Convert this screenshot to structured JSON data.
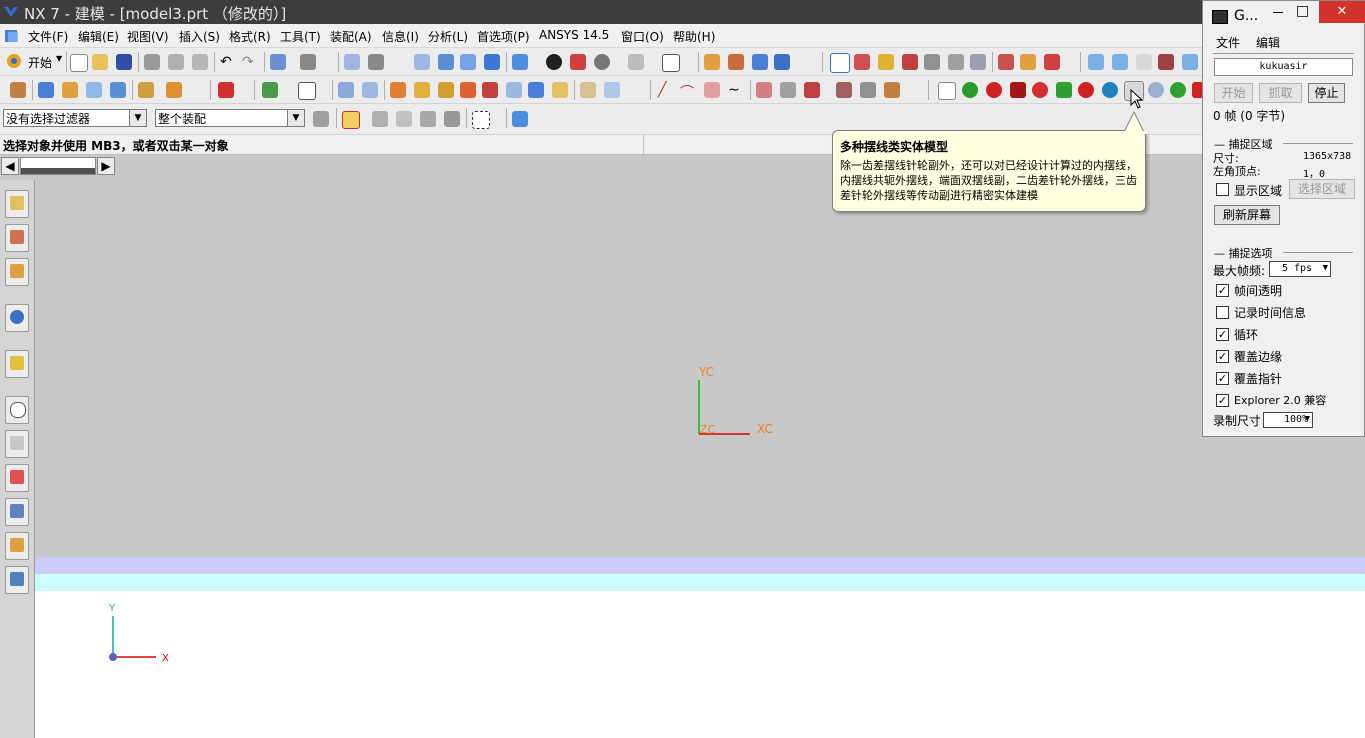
{
  "window": {
    "title": "NX 7 - 建模 - [model3.prt （修改的）]"
  },
  "menu": [
    {
      "label": "文件(F)"
    },
    {
      "label": "编辑(E)"
    },
    {
      "label": "视图(V)"
    },
    {
      "label": "插入(S)"
    },
    {
      "label": "格式(R)"
    },
    {
      "label": "工具(T)"
    },
    {
      "label": "装配(A)"
    },
    {
      "label": "信息(I)"
    },
    {
      "label": "分析(L)"
    },
    {
      "label": "首选项(P)"
    },
    {
      "label": "ANSYS 14.5"
    },
    {
      "label": "窗口(O)"
    },
    {
      "label": "帮助(H)"
    }
  ],
  "toolbar": {
    "start_label": "开始"
  },
  "filters": {
    "type_filter": "没有选择过滤器",
    "scope_filter": "整个装配"
  },
  "cue_line": "选择对象并使用 MB3，或者双击某一对象",
  "tooltip": {
    "title": "多种摆线类实体模型",
    "body": "除一齿差摆线针轮副外，还可以对已经设计计算过的内摆线，内摆线共轭外摆线，端面双摆线副，二齿差针轮外摆线，三齿差针轮外摆线等传动副进行精密实体建模"
  },
  "axes": {
    "wcs_y": "YC",
    "wcs_x": "XC",
    "wcs_z": "ZC",
    "abs_y": "Y",
    "abs_x": "X"
  },
  "recorder": {
    "title": "G...",
    "menu_file": "文件",
    "menu_edit": "编辑",
    "name": "kukuasir",
    "btn_start": "开始",
    "btn_capture": "抓取",
    "btn_stop": "停止",
    "frame_info": "0 帧 (0 字节)",
    "capture_area_header": "捕捉区域",
    "size_label": "尺寸:",
    "size_value": "1365x738",
    "topleft_label": "左角顶点:",
    "topleft_value": "1，0",
    "show_area_label": "显示区域",
    "select_area_btn": "选择区域",
    "refresh_btn": "刷新屏幕",
    "capture_opts_header": "捕捉选项",
    "max_fps_label": "最大帧频:",
    "max_fps_value": "5 fps",
    "opt_transparent": "帧间透明",
    "opt_timeinfo": "记录时间信息",
    "opt_loop": "循环",
    "opt_edges": "覆盖边缘",
    "opt_cursor": "覆盖指针",
    "opt_explorer": "Explorer 2.0 兼容",
    "rec_size_label": "录制尺寸",
    "rec_size_value": "100%",
    "minimize": "□",
    "close": "✕"
  },
  "colors": {
    "title_bg": "#3d3d3d",
    "graphics_bg": "#c8c8c8",
    "band1": "#ccccf8",
    "band2": "#ccfcfc",
    "axis_x": "#e00000",
    "axis_y": "#00c000",
    "axis_label": "#f08020",
    "tooltip_bg": "#ffffe1",
    "close_red": "#d0332b"
  }
}
